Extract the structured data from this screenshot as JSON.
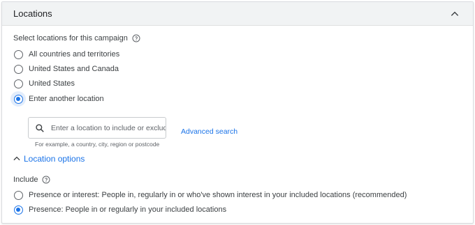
{
  "section": {
    "title": "Locations"
  },
  "locations": {
    "prompt": "Select locations for this campaign",
    "options": [
      {
        "label": "All countries and territories",
        "selected": false
      },
      {
        "label": "United States and Canada",
        "selected": false
      },
      {
        "label": "United States",
        "selected": false
      },
      {
        "label": "Enter another location",
        "selected": true
      }
    ]
  },
  "search": {
    "placeholder": "Enter a location to include or exclude",
    "value": "",
    "helper": "For example, a country, city, region or postcode",
    "advanced_link": "Advanced search"
  },
  "location_options": {
    "toggle_label": "Location options",
    "include_label": "Include",
    "options": [
      {
        "label": "Presence or interest: People in, regularly in or who've shown interest in your included locations (recommended)",
        "selected": false
      },
      {
        "label": "Presence: People in or regularly in your included locations",
        "selected": true
      }
    ]
  },
  "colors": {
    "accent": "#1a73e8",
    "header_bg": "#f1f3f4",
    "text": "#3c4043"
  }
}
